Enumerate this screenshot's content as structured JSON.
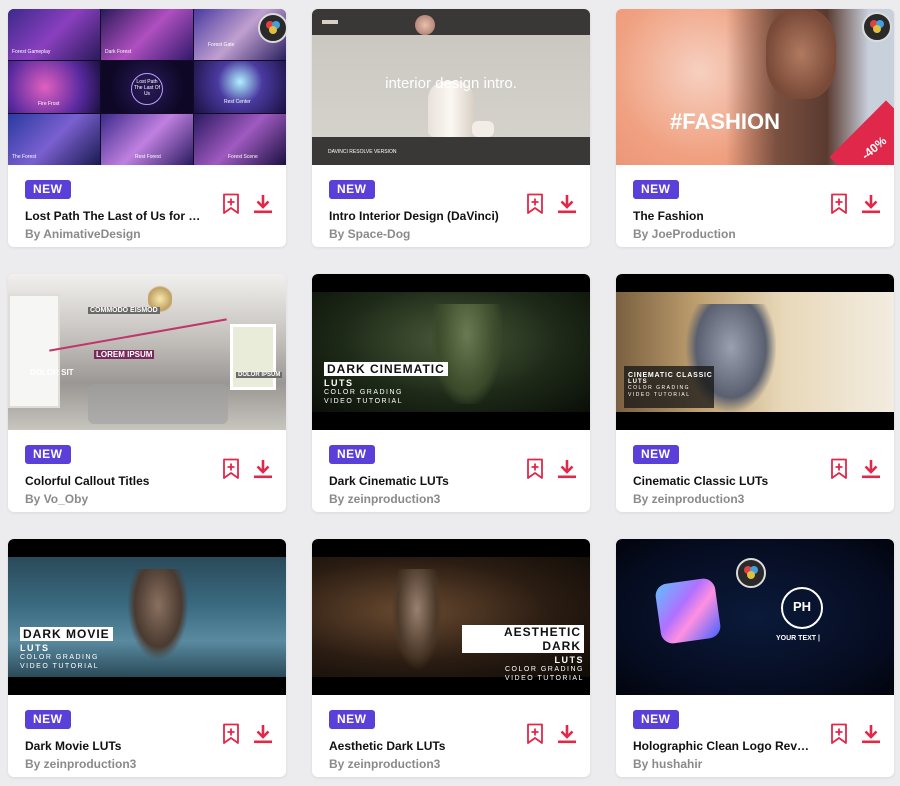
{
  "badge_label": "NEW",
  "colors": {
    "accent": "#e0284a",
    "badge": "#5a3fd8"
  },
  "icons": {
    "bookmark": "bookmark-plus-icon",
    "download": "download-icon"
  },
  "cards": [
    {
      "title": "Lost Path The Last of Us for D...",
      "author": "By AnimativeDesign",
      "thumb": {
        "tiles": [
          "Forest Gameplay",
          "Dark Forest",
          "Forest Gate",
          "Fire Frost",
          "Lost Path\nThe Last Of Us",
          "Rest Center",
          "The Forest",
          "Rest Forest",
          "Forest Scene"
        ]
      }
    },
    {
      "title": "Intro Interior Design (DaVinci)",
      "author": "By Space-Dog",
      "thumb": {
        "headline": "interior design intro.",
        "footer": "DAVINCI RESOLVE VERSION"
      }
    },
    {
      "title": "The Fashion",
      "author": "By JoeProduction",
      "thumb": {
        "headline": "#FASHION",
        "sale": "-40%"
      }
    },
    {
      "title": "Colorful Callout Titles",
      "author": "By Vo_Oby",
      "thumb": {
        "callouts": [
          "COMMODO EISMOD",
          "LOREM IPSUM",
          "DOLOR SIT",
          "DOLOR IPSUM"
        ]
      }
    },
    {
      "title": "Dark Cinematic LUTs",
      "author": "By zeinproduction3",
      "thumb": {
        "headline": "DARK CINEMATIC",
        "line2": "LUTS",
        "line3": "COLOR GRADING",
        "line4": "VIDEO TUTORIAL"
      }
    },
    {
      "title": "Cinematic Classic LUTs",
      "author": "By zeinproduction3",
      "thumb": {
        "headline": "CINEMATIC CLASSIC",
        "line2": "LUTS",
        "line3": "COLOR GRADING",
        "line4": "VIDEO TUTORIAL"
      }
    },
    {
      "title": "Dark Movie LUTs",
      "author": "By zeinproduction3",
      "thumb": {
        "headline": "DARK MOVIE",
        "line2": "LUTS",
        "line3": "COLOR GRADING",
        "line4": "VIDEO TUTORIAL"
      }
    },
    {
      "title": "Aesthetic Dark LUTs",
      "author": "By zeinproduction3",
      "thumb": {
        "headline": "AESTHETIC DARK",
        "line2": "LUTS",
        "line3": "COLOR GRADING",
        "line4": "VIDEO TUTORIAL"
      }
    },
    {
      "title": "Holographic Clean Logo Reveal",
      "author": "By hushahir",
      "thumb": {
        "logo_mark": "PH",
        "tagline": "YOUR TEXT |"
      }
    }
  ]
}
